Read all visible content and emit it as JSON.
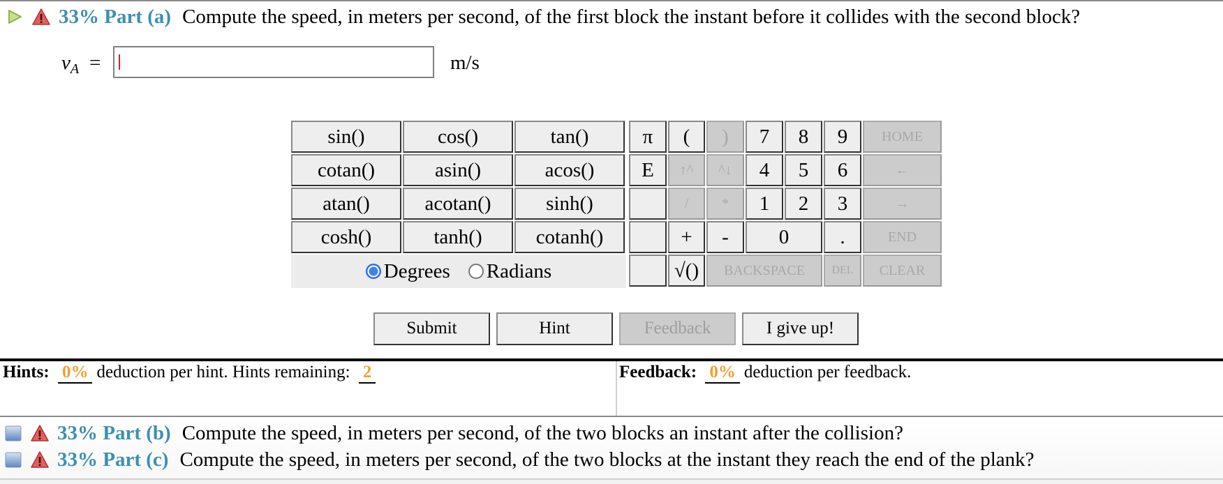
{
  "part_a": {
    "icon_expand": "play-triangle-icon",
    "icon_status": "warning-icon",
    "percent": "33%",
    "label": "Part (a)",
    "question": "Compute the speed, in meters per second, of the first block the instant before it collides with the second block?"
  },
  "answer": {
    "variable": "v",
    "subscript": "A",
    "equals": "=",
    "value": "",
    "unit": "m/s"
  },
  "functions": [
    [
      "sin()",
      "cos()",
      "tan()"
    ],
    [
      "cotan()",
      "asin()",
      "acos()"
    ],
    [
      "atan()",
      "acotan()",
      "sinh()"
    ],
    [
      "cosh()",
      "tanh()",
      "cotanh()"
    ]
  ],
  "angle_mode": {
    "options": [
      "Degrees",
      "Radians"
    ],
    "selected": "Degrees"
  },
  "keypad": {
    "pi": "π",
    "e": "E",
    "lparen": "(",
    "rparen": ")",
    "up": "↑^",
    "down": "^↓",
    "div": "/",
    "mul": "*",
    "plus": "+",
    "minus": "-",
    "sqrt": "√()",
    "d7": "7",
    "d8": "8",
    "d9": "9",
    "d4": "4",
    "d5": "5",
    "d6": "6",
    "d1": "1",
    "d2": "2",
    "d3": "3",
    "d0": "0",
    "dot": ".",
    "home": "HOME",
    "left": "←",
    "right": "→",
    "end": "END",
    "backspace": "BACKSPACE",
    "del": "DEL",
    "clear": "CLEAR"
  },
  "actions": {
    "submit": "Submit",
    "hint": "Hint",
    "feedback": "Feedback",
    "give_up": "I give up!"
  },
  "hints": {
    "label": "Hints:",
    "deduction": "0%",
    "text": "deduction per hint. Hints remaining:",
    "remaining": "2"
  },
  "feedback": {
    "label": "Feedback:",
    "deduction": "0%",
    "text": "deduction per feedback."
  },
  "part_b": {
    "icon_expand": "collapsed-box-icon",
    "icon_status": "warning-icon",
    "percent": "33%",
    "label": "Part (b)",
    "question": "Compute the speed, in meters per second, of the two blocks an instant after the collision?"
  },
  "part_c": {
    "icon_expand": "collapsed-box-icon",
    "icon_status": "warning-icon",
    "percent": "33%",
    "label": "Part (c)",
    "question": "Compute the speed, in meters per second, of the two blocks at the instant they reach the end of the plank?"
  },
  "colors": {
    "part_label": "#3d8fb0",
    "deduction_value": "#f0a030",
    "radio_selected": "#3b82f6",
    "disabled_key": "#cccccc"
  }
}
